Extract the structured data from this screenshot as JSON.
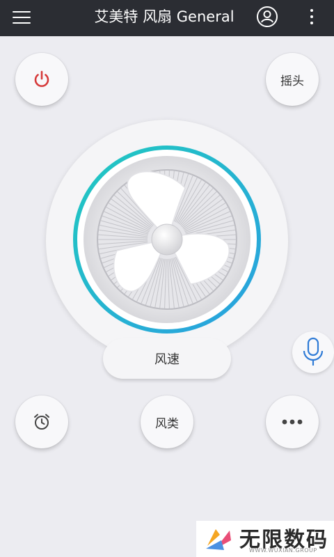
{
  "header": {
    "title": "艾美特 风扇 General",
    "menu_icon": "hamburger-menu-icon",
    "user_icon": "user-account-icon",
    "more_icon": "more-vertical-icon",
    "background": "#2b2d33"
  },
  "controls": {
    "power_icon": "power-icon",
    "power_color": "#d63a3a",
    "swing_label": "摇头",
    "speed_label": "风速",
    "mode_label": "风类",
    "timer_icon": "alarm-clock-icon",
    "more_icon": "more-horizontal-icon",
    "mic_icon": "microphone-icon",
    "mic_color": "#2f7bd6"
  },
  "fan": {
    "ring_gradient": [
      "#20c9c0",
      "#2aa0e0"
    ]
  },
  "watermark": {
    "text": "无限数码",
    "subtext": "WWW.WUXIAN.GROUP"
  }
}
